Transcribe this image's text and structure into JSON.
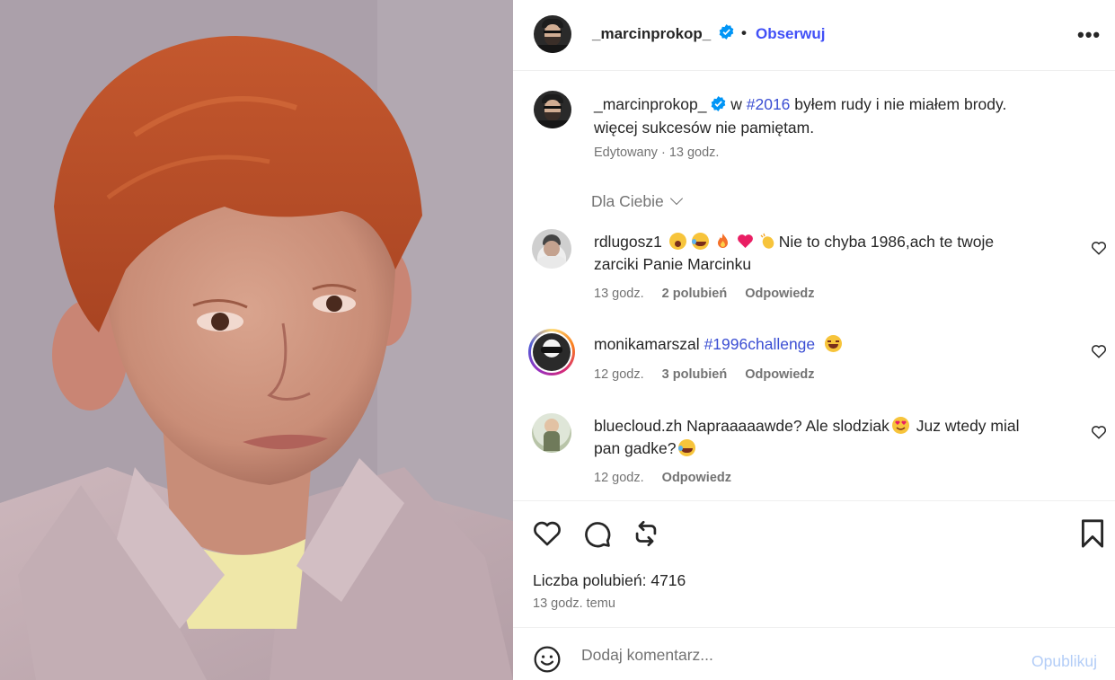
{
  "post": {
    "author": "_marcinprokop_",
    "follow_label": "Obserwuj",
    "separator": "•",
    "more_label": "•••",
    "caption": {
      "prefix": "w",
      "hashtag": "#2016",
      "line1_rest": "byłem rudy i nie miałem brody.",
      "line2": "więcej sukcesów nie pamiętam."
    },
    "caption_meta": "Edytowany · 13 godz."
  },
  "sort": {
    "label": "Dla Ciebie"
  },
  "comments": [
    {
      "user": "rdlugosz1",
      "text": "Nie to chyba 1986,ach te twoje zarciki Panie Marcinku",
      "text_line1": "Nie to chyba 1986,ach te twoje",
      "text_line2": "zarciki Panie Marcinku",
      "time": "13 godz.",
      "likes": "2 polubień",
      "reply": "Odpowiedz"
    },
    {
      "user": "monikamarszal",
      "hashtag": "#1996challenge",
      "time": "12 godz.",
      "likes": "3 polubień",
      "reply": "Odpowiedz"
    },
    {
      "user": "bluecloud.zh",
      "text_line1": "Napraaaaawde? Ale slodziak",
      "text_line1b": "Juz wtedy mial",
      "text_line2": "pan gadke?",
      "time": "12 godz.",
      "reply": "Odpowiedz"
    }
  ],
  "stats": {
    "likes": "Liczba polubień: 4716",
    "ago": "13 godz. temu"
  },
  "add_comment": {
    "placeholder": "Dodaj komentarz...",
    "publish_label": "Opublikuj"
  },
  "colors": {
    "link": "#4150f7",
    "hashtag": "#3b4ed3",
    "muted": "#737373",
    "publish_disabled": "#b3cdf7",
    "verified": "#0095f6"
  }
}
